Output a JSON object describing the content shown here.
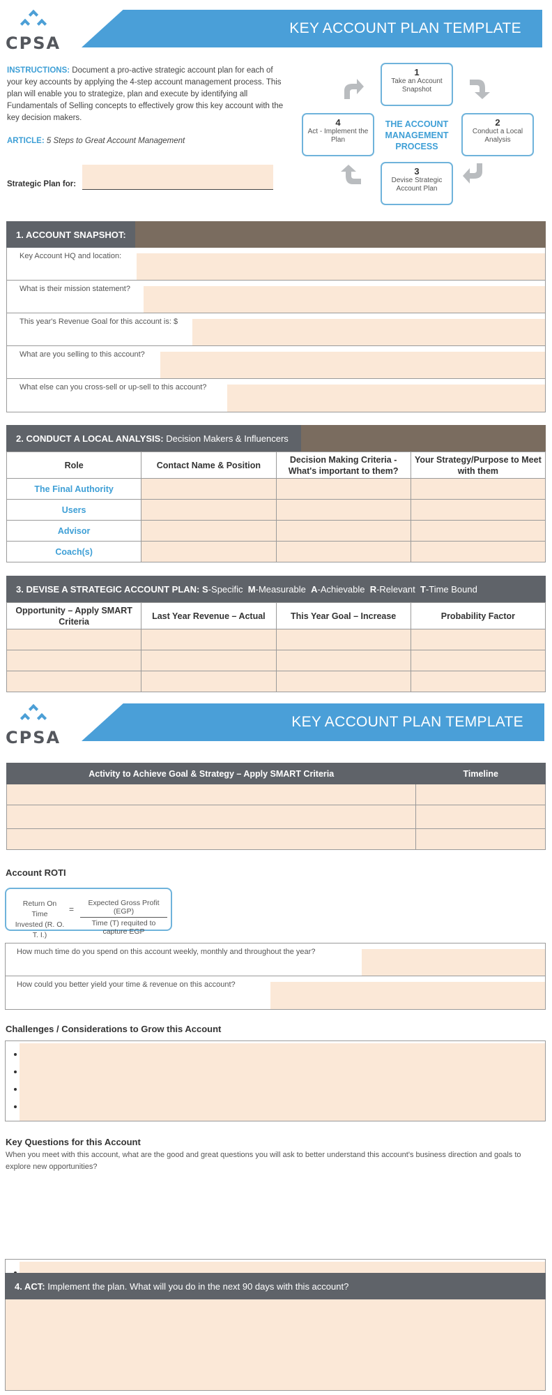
{
  "brand": {
    "logo_text": "CPSA",
    "accent": "#4a9fd8",
    "fill": "#fbe8d7",
    "header_dark": "#5f6369",
    "header_brown": "#7a6c5f"
  },
  "page1": {
    "banner_title": "KEY ACCOUNT PLAN TEMPLATE",
    "instructions_label": "INSTRUCTIONS:",
    "instructions_text": " Document a pro-active strategic account plan for each of your key accounts by applying the 4-step account management process. This plan will enable you to strategize, plan and execute by identifying all Fundamentals of Selling concepts to effectively grow this key account with the key decision makers.",
    "article_label": "ARTICLE:",
    "article_title": " 5 Steps to Great Account Management",
    "strategic_plan_label": "Strategic Plan for:",
    "process": {
      "center_title": [
        "THE ACCOUNT",
        "MANAGEMENT",
        "PROCESS"
      ],
      "steps": [
        {
          "num": "1",
          "text": "Take an Account Snapshot"
        },
        {
          "num": "2",
          "text": "Conduct a Local Analysis"
        },
        {
          "num": "3",
          "text": "Devise Strategic Account Plan"
        },
        {
          "num": "4",
          "text": "Act - Implement the Plan"
        }
      ]
    },
    "section1": {
      "title": "1. ACCOUNT SNAPSHOT:",
      "rows": [
        "Key Account HQ and location:",
        "What is their mission statement?",
        "This year's Revenue Goal for this account is: $",
        "What are you selling to this account?",
        "What else can you cross-sell or up-sell to this account?"
      ]
    },
    "section2": {
      "title_bold": "2. CONDUCT A LOCAL ANALYSIS:",
      "title_light": " Decision Makers & Influencers",
      "columns": [
        "Role",
        "Contact Name & Position",
        "Decision Making Criteria - What's important to them?",
        "Your Strategy/Purpose to Meet with them"
      ],
      "roles": [
        "The Final Authority",
        "Users",
        "Advisor",
        "Coach(s)"
      ]
    },
    "section3": {
      "title_bold": "3. DEVISE A STRATEGIC ACCOUNT PLAN:",
      "smart": [
        {
          "letter": "S",
          "word": "-Specific"
        },
        {
          "letter": "M",
          "word": "-Measurable"
        },
        {
          "letter": "A",
          "word": "-Achievable"
        },
        {
          "letter": "R",
          "word": "-Relevant"
        },
        {
          "letter": "T",
          "word": "-Time Bound"
        }
      ],
      "columns": [
        "Opportunity – Apply SMART Criteria",
        "Last Year Revenue – Actual",
        "This Year Goal – Increase",
        "Probability Factor"
      ],
      "row_count": 3
    }
  },
  "page2": {
    "banner_title": "KEY ACCOUNT PLAN TEMPLATE",
    "activity_table": {
      "columns": [
        "Activity to Achieve Goal & Strategy – Apply SMART Criteria",
        "Timeline"
      ],
      "row_count": 3
    },
    "roti": {
      "heading": "Account ROTI",
      "lhs_line1": "Return On Time",
      "lhs_line2": "Invested (R. O. T. I.)",
      "equals": "=",
      "numerator": "Expected Gross Profit (EGP)",
      "denominator": "Time (T) requited to capture EGP",
      "questions": [
        "How much time do you spend on this account weekly, monthly and throughout the year?",
        "How could you better yield your time & revenue on this account?"
      ]
    },
    "challenges": {
      "heading": "Challenges / Considerations to Grow this Account",
      "bullets": 4
    },
    "key_questions": {
      "heading": "Key Questions for this Account",
      "description": "When you meet with this account, what are the good and great questions you will ask to better understand this account's business direction and goals to explore new opportunities?",
      "bullets": 4
    },
    "section4": {
      "title_bold": "4. ACT:",
      "title_light": " Implement the plan. What will you do in the next 90 days with this account?"
    }
  }
}
